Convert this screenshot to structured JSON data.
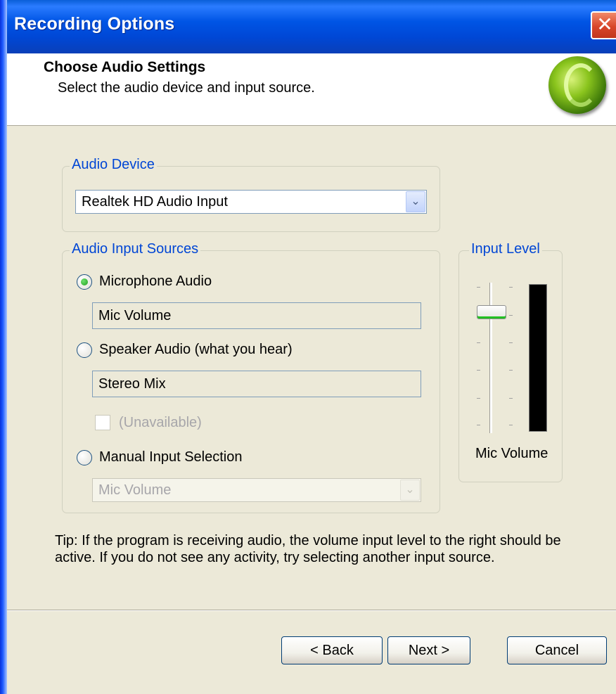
{
  "window": {
    "title": "Recording Options",
    "close_glyph": "✕"
  },
  "header": {
    "title": "Choose Audio Settings",
    "subtitle": "Select the audio device and input source.",
    "logo_icon": "green-sphere-logo-icon"
  },
  "audio_device": {
    "group_label": "Audio Device",
    "selected": "Realtek HD Audio Input",
    "arrow_glyph": "⌄"
  },
  "input_sources": {
    "group_label": "Audio Input Sources",
    "microphone": {
      "label": "Microphone Audio",
      "checked": true,
      "line": "Mic Volume"
    },
    "speaker": {
      "label": "Speaker Audio (what you hear)",
      "checked": false,
      "line": "Stereo Mix"
    },
    "unavailable_checkbox": {
      "label": "(Unavailable)",
      "checked": false,
      "enabled": false
    },
    "manual": {
      "label": "Manual Input Selection",
      "checked": false,
      "selected": "Mic Volume",
      "enabled": false,
      "arrow_glyph": "⌄"
    }
  },
  "input_level": {
    "group_label": "Input Level",
    "caption": "Mic Volume",
    "slider_value_fraction": 0.82,
    "meter_level_fraction": 0.0
  },
  "tip": "Tip: If the program is receiving audio, the volume input level to the right should be active.  If you do not see any activity, try selecting another input source.",
  "buttons": {
    "back": "< Back",
    "next": "Next >",
    "cancel": "Cancel"
  },
  "colors": {
    "accent": "#0046d5",
    "titlebar": "#0055e5",
    "dialog_bg": "#ece9d8",
    "close": "#d8462a"
  }
}
